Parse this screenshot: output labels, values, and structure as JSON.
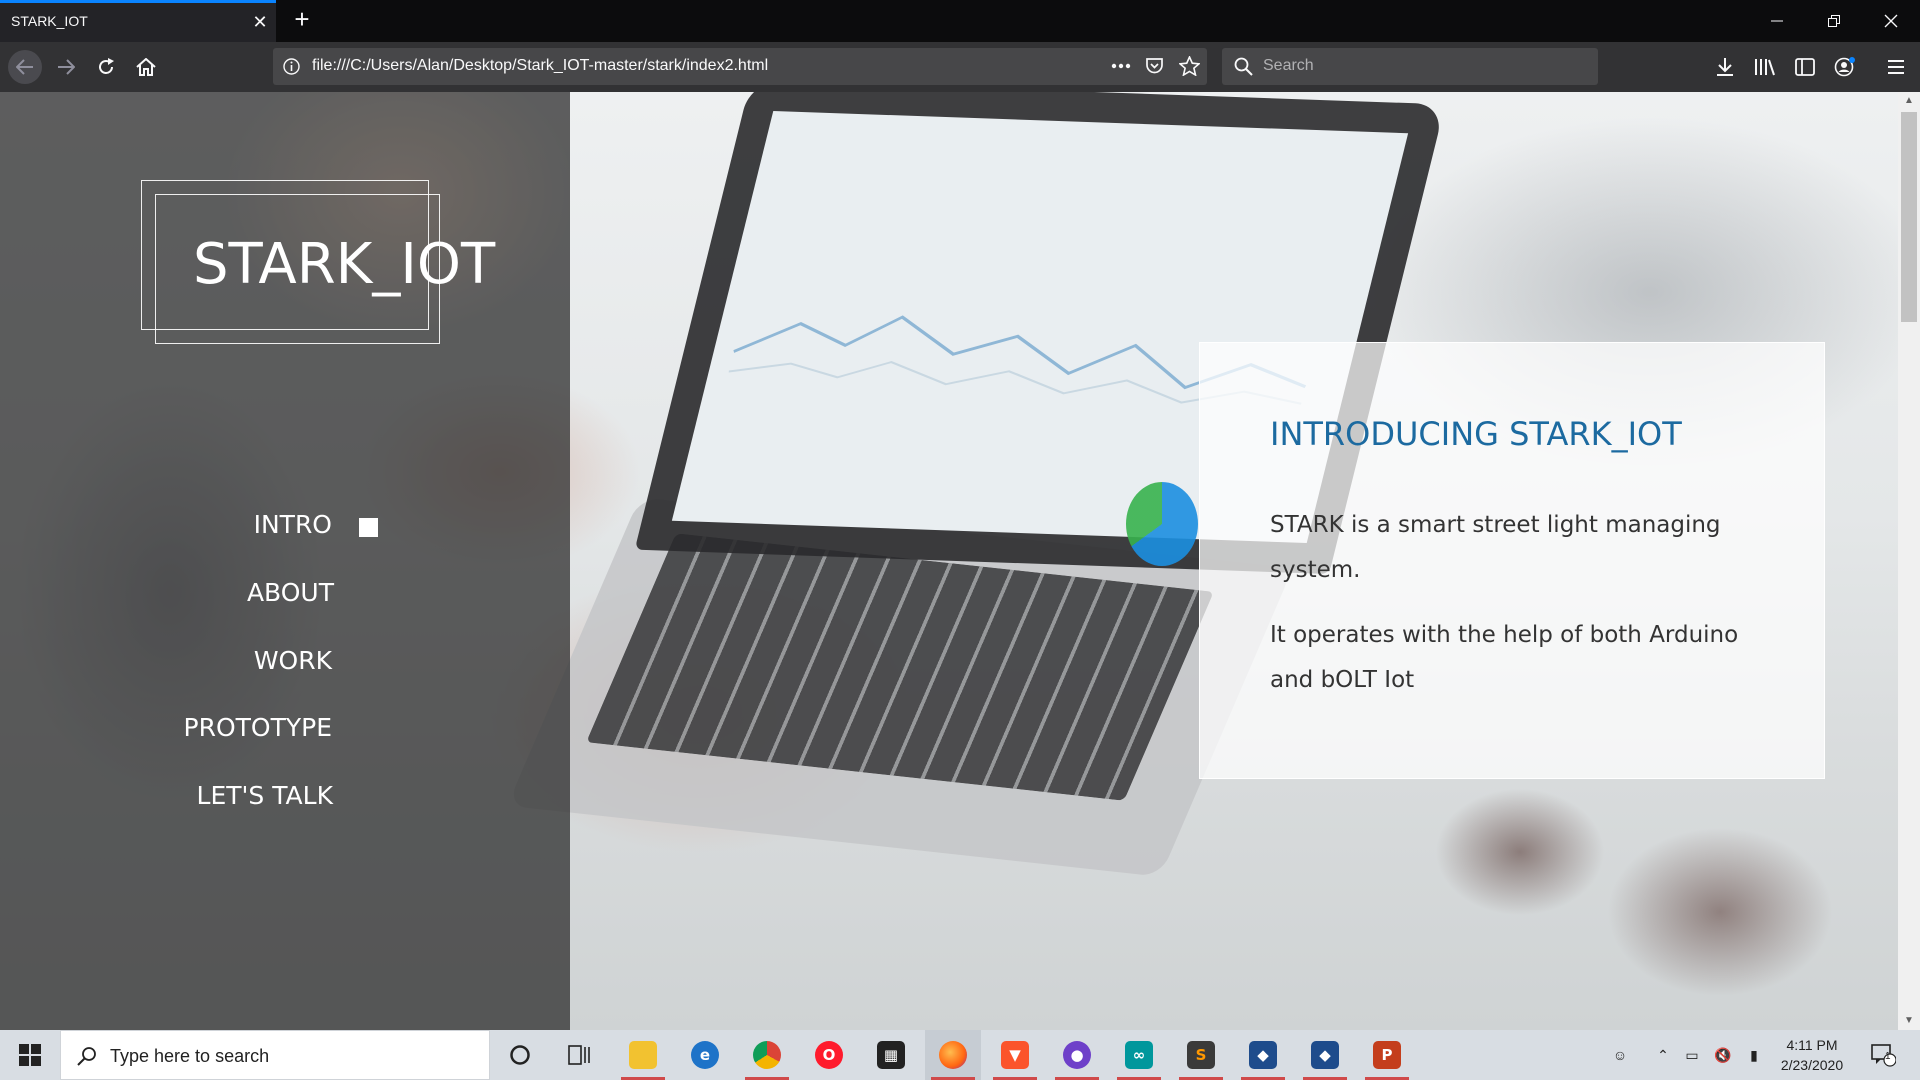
{
  "browser": {
    "tab": {
      "title": "STARK_IOT",
      "close_glyph": "✕"
    },
    "new_tab_glyph": "+",
    "url": "file:///C:/Users/Alan/Desktop/Stark_IOT-master/stark/index2.html",
    "search_placeholder": "Search",
    "toolbar_icons": [
      "back-icon",
      "forward-icon",
      "reload-icon",
      "home-icon",
      "info-icon",
      "page-actions-icon",
      "pocket-icon",
      "bookmark-star-icon",
      "download-icon",
      "library-icon",
      "sidebar-icon",
      "account-icon",
      "menu-icon"
    ],
    "window_controls": [
      "minimize",
      "restore",
      "close"
    ]
  },
  "page": {
    "logo": "STARK_IOT",
    "menu": [
      {
        "label": "INTRO",
        "active": true
      },
      {
        "label": "ABOUT",
        "active": false
      },
      {
        "label": "WORK",
        "active": false
      },
      {
        "label": "PROTOTYPE",
        "active": false
      },
      {
        "label": "LET'S TALK",
        "active": false
      }
    ],
    "intro": {
      "title": "INTRODUCING STARK_IOT",
      "paragraphs": [
        "STARK is a smart street light managing system.",
        "It operates with the help of both Arduino and bOLT Iot"
      ]
    },
    "colors": {
      "title": "#1c6aa0",
      "accent_tab": "#0a84ff"
    }
  },
  "taskbar": {
    "search_placeholder": "Type here to search",
    "apps": [
      "cortana",
      "task-view",
      "file-explorer",
      "edge",
      "chrome",
      "opera",
      "store",
      "firefox",
      "brave",
      "github-desktop",
      "arduino",
      "sublime-text",
      "virtualbox",
      "virtualbox-2",
      "powerpoint"
    ],
    "clock_time": "4:11 PM",
    "clock_date": "2/23/2020",
    "notification_count": "1"
  }
}
